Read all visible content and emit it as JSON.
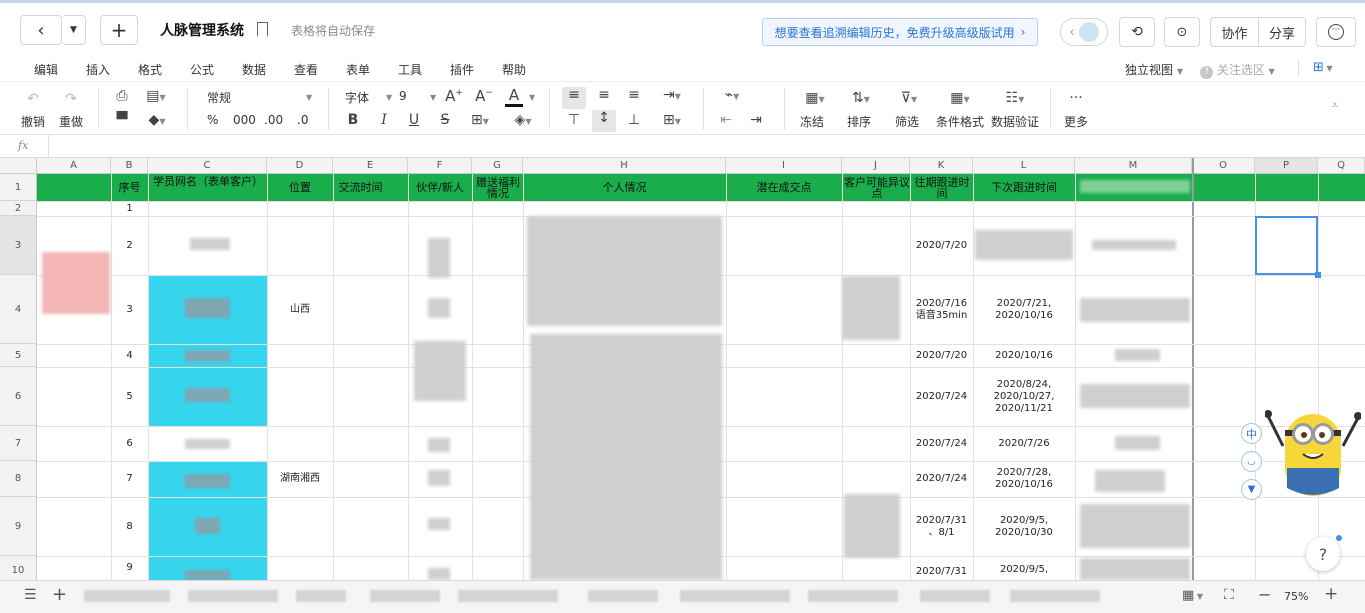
{
  "titlebar": {
    "doc_title": "人脉管理系统",
    "autosave": "表格将自动保存",
    "upgrade_banner": "想要查看追溯编辑历史，免费升级高级版试用",
    "collab_label": "协作",
    "share_label": "分享"
  },
  "menubar": {
    "items": [
      "编辑",
      "插入",
      "格式",
      "公式",
      "数据",
      "查看",
      "表单",
      "工具",
      "插件",
      "帮助"
    ],
    "view_label": "独立视图",
    "follow_label": "关注选区"
  },
  "toolbar": {
    "undo": "撤销",
    "redo": "重做",
    "number_format": "常规",
    "percent": "%",
    "thousands": "000",
    "dec_inc": ".00",
    "dec_dec": ".0",
    "font_name": "字体",
    "font_size": "9",
    "freeze": "冻结",
    "sort": "排序",
    "filter": "筛选",
    "cond_format": "条件格式",
    "data_validation": "数据验证",
    "more": "更多"
  },
  "formula_bar": {
    "fx": "fx",
    "value": ""
  },
  "columns": [
    "A",
    "B",
    "C",
    "D",
    "E",
    "F",
    "G",
    "H",
    "I",
    "J",
    "K",
    "L",
    "M",
    "O",
    "P",
    "Q"
  ],
  "rows": [
    "1",
    "2",
    "3",
    "4",
    "5",
    "6",
    "7",
    "8",
    "9",
    "10"
  ],
  "headers": {
    "seq": "序号",
    "member": "学员网名（表单客户）",
    "location": "位置",
    "talk_time": "交流时间",
    "partner": "伙伴/新人",
    "gift": "赠送福利情况",
    "personal": "个人情况",
    "potential": "潜在成交点",
    "objection": "客户可能异议点",
    "past_follow": "往期跟进时间",
    "next_follow": "下次跟进时间"
  },
  "table_rows": [
    {
      "seq": "1",
      "location": "",
      "past": "",
      "next": ""
    },
    {
      "seq": "2",
      "location": "",
      "past": "2020/7/20",
      "next": ""
    },
    {
      "seq": "3",
      "location": "山西",
      "past": "2020/7/16\n语音35min",
      "next": "2020/7/21,\n2020/10/16"
    },
    {
      "seq": "4",
      "location": "",
      "past": "2020/7/20",
      "next": "2020/10/16"
    },
    {
      "seq": "5",
      "location": "",
      "past": "2020/7/24",
      "next": "2020/8/24,\n2020/10/27,\n2020/11/21"
    },
    {
      "seq": "6",
      "location": "",
      "past": "2020/7/24",
      "next": "2020/7/26"
    },
    {
      "seq": "7",
      "location": "湖南湘西",
      "past": "2020/7/24",
      "next": "2020/7/28,\n2020/10/16"
    },
    {
      "seq": "8",
      "location": "",
      "past": "2020/7/31\n、8/1",
      "next": "2020/9/5,\n2020/10/30"
    },
    {
      "seq": "9",
      "location": "",
      "past": "2020/7/31",
      "next": "2020/9/5,"
    }
  ],
  "side_icons": {
    "lang": "中"
  },
  "bottom": {
    "zoom": "75%",
    "help": "?"
  },
  "colors": {
    "header_green": "#1aad4b",
    "highlight_cyan": "#35d6ee",
    "accent_blue": "#2b73d6"
  }
}
